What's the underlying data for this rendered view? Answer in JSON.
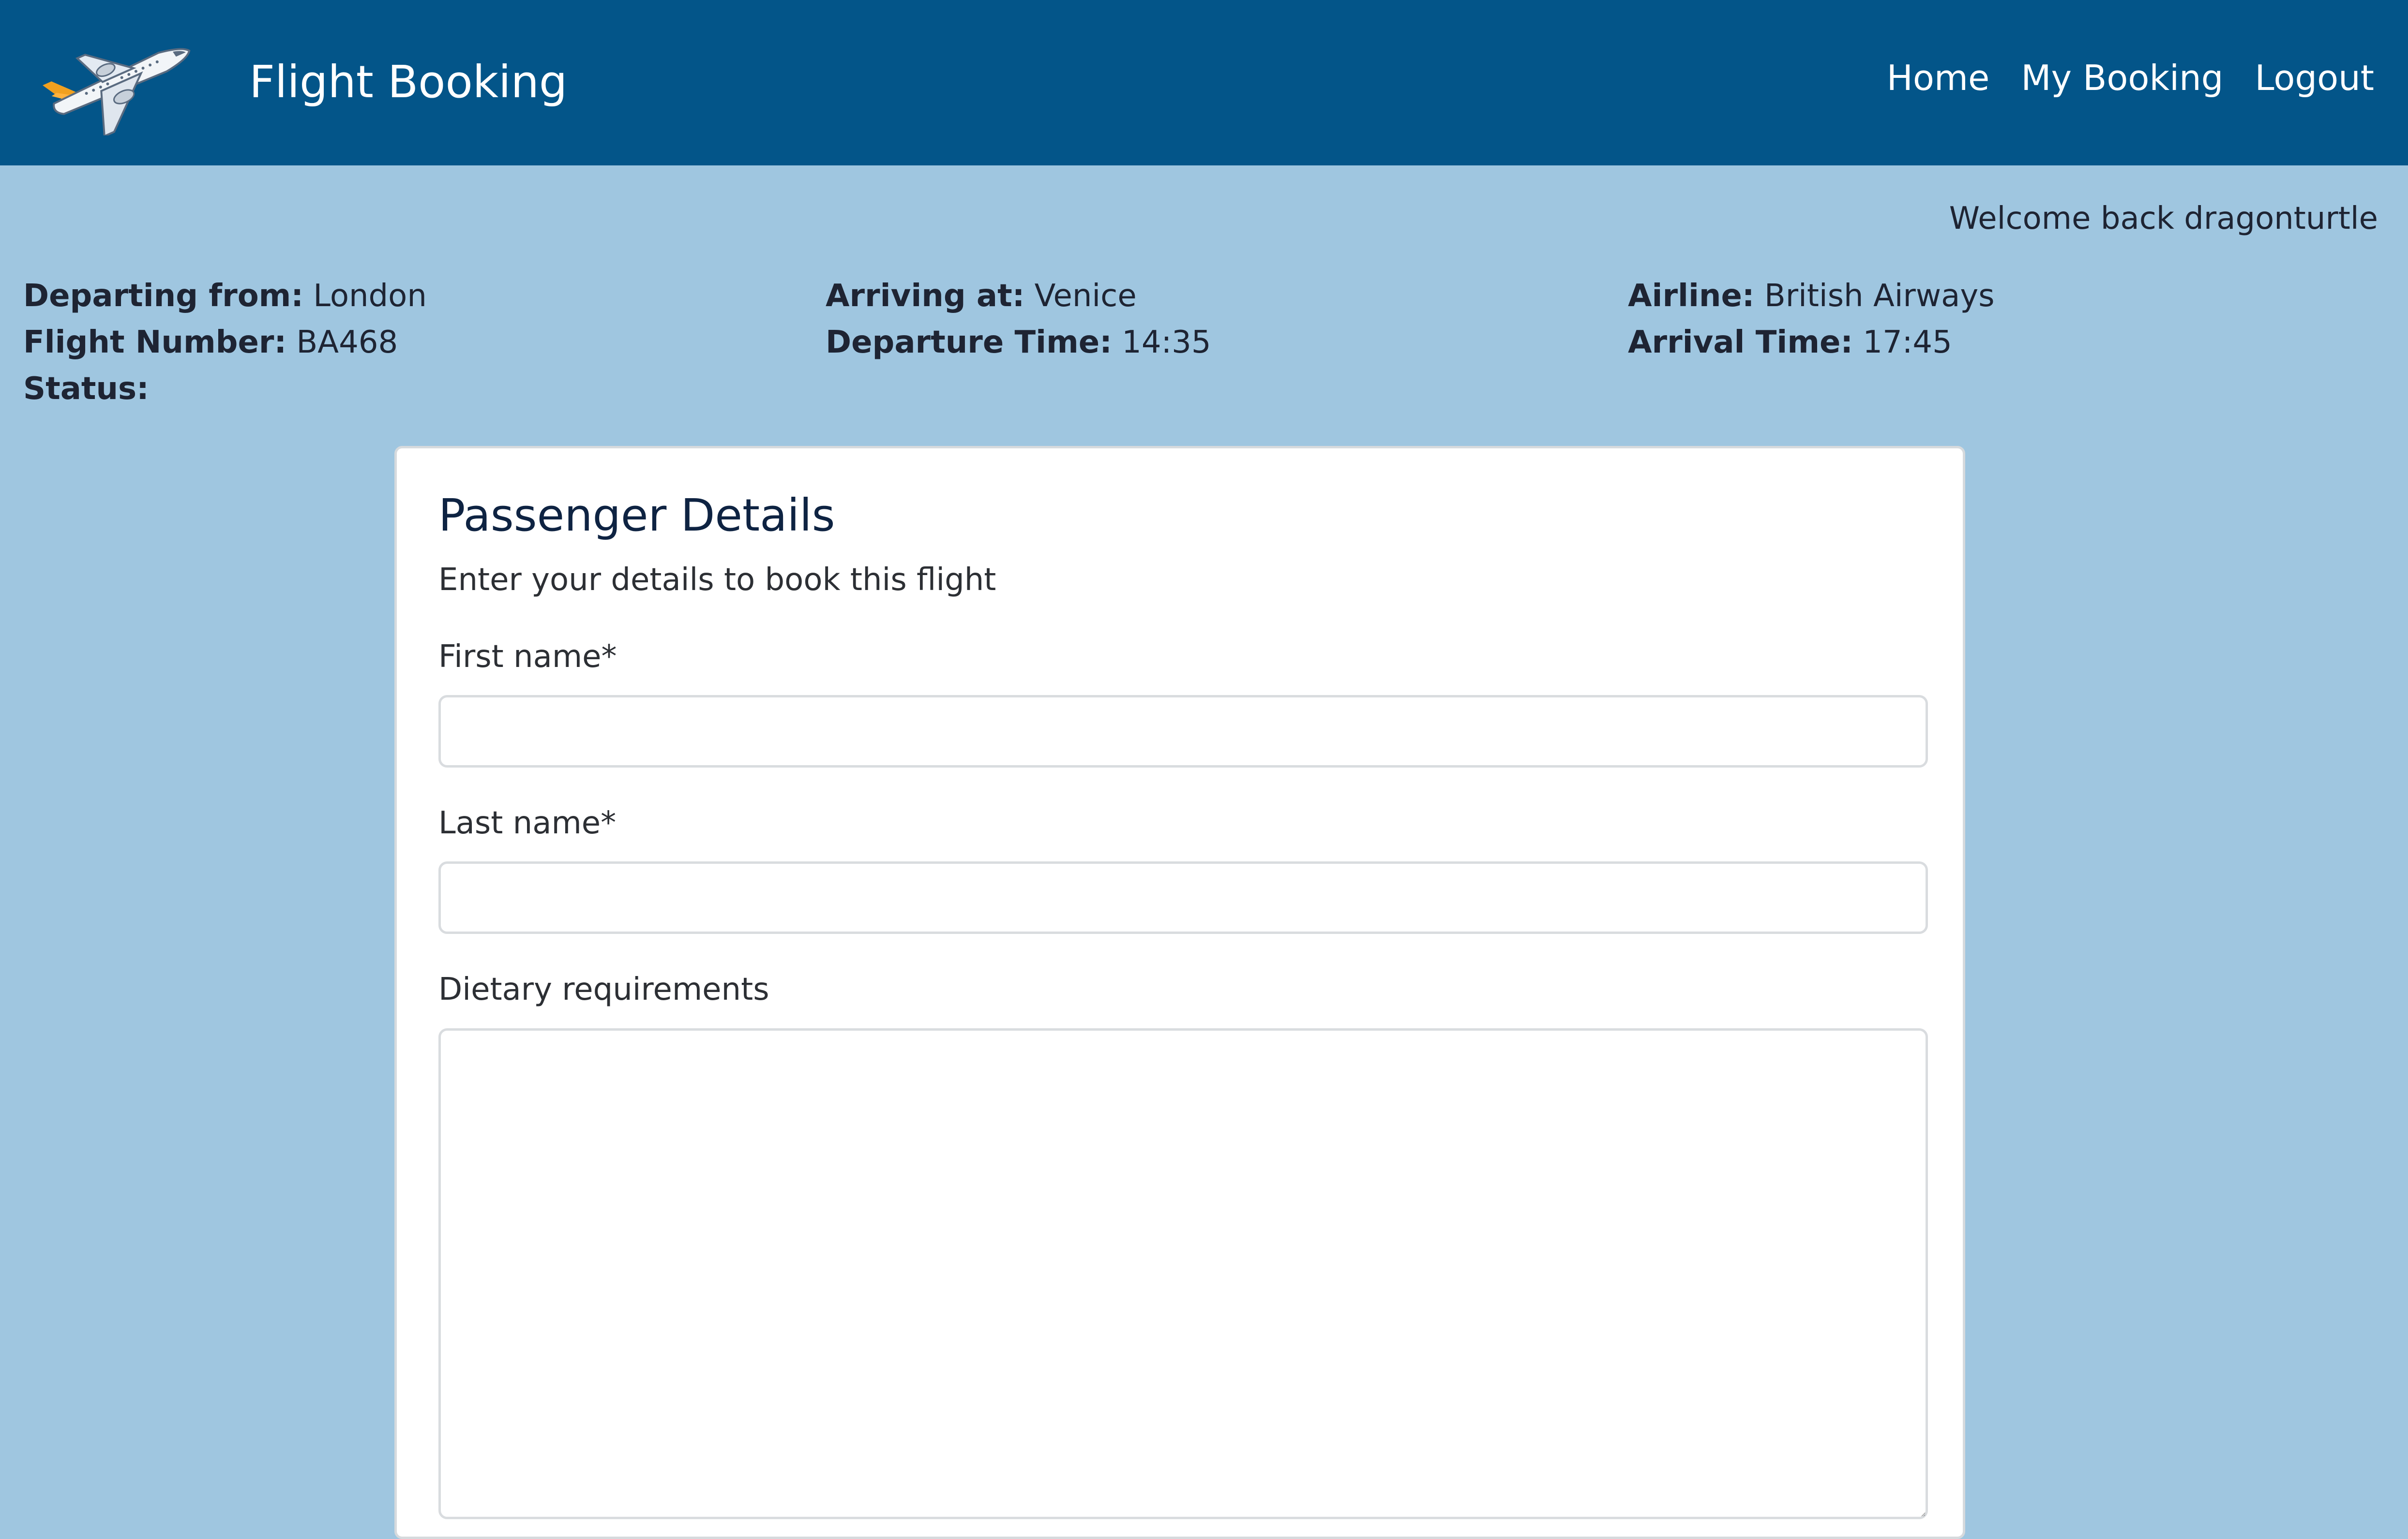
{
  "header": {
    "brand_title": "Flight Booking",
    "logo_icon": "airplane-icon",
    "nav_items": [
      {
        "label": "Home"
      },
      {
        "label": "My Booking"
      },
      {
        "label": "Logout"
      }
    ]
  },
  "welcome_text": "Welcome back dragonturtle",
  "flight": {
    "departing_from": {
      "label": "Departing from:",
      "value": "London"
    },
    "arriving_at": {
      "label": "Arriving at:",
      "value": "Venice"
    },
    "airline": {
      "label": "Airline:",
      "value": "British Airways"
    },
    "flight_number": {
      "label": "Flight Number:",
      "value": "BA468"
    },
    "departure_time": {
      "label": "Departure Time:",
      "value": "14:35"
    },
    "arrival_time": {
      "label": "Arrival Time:",
      "value": "17:45"
    },
    "status": {
      "label": "Status:",
      "value": ""
    }
  },
  "form": {
    "title": "Passenger Details",
    "subtitle": "Enter your details to book this flight",
    "first_name": {
      "label": "First name*",
      "value": ""
    },
    "last_name": {
      "label": "Last name*",
      "value": ""
    },
    "dietary": {
      "label": "Dietary requirements",
      "value": ""
    }
  },
  "colors": {
    "navbar": "#035589",
    "page_background": "#9fc6e0",
    "card_background": "#ffffff",
    "plane_tail_accent": "#f0a020"
  }
}
